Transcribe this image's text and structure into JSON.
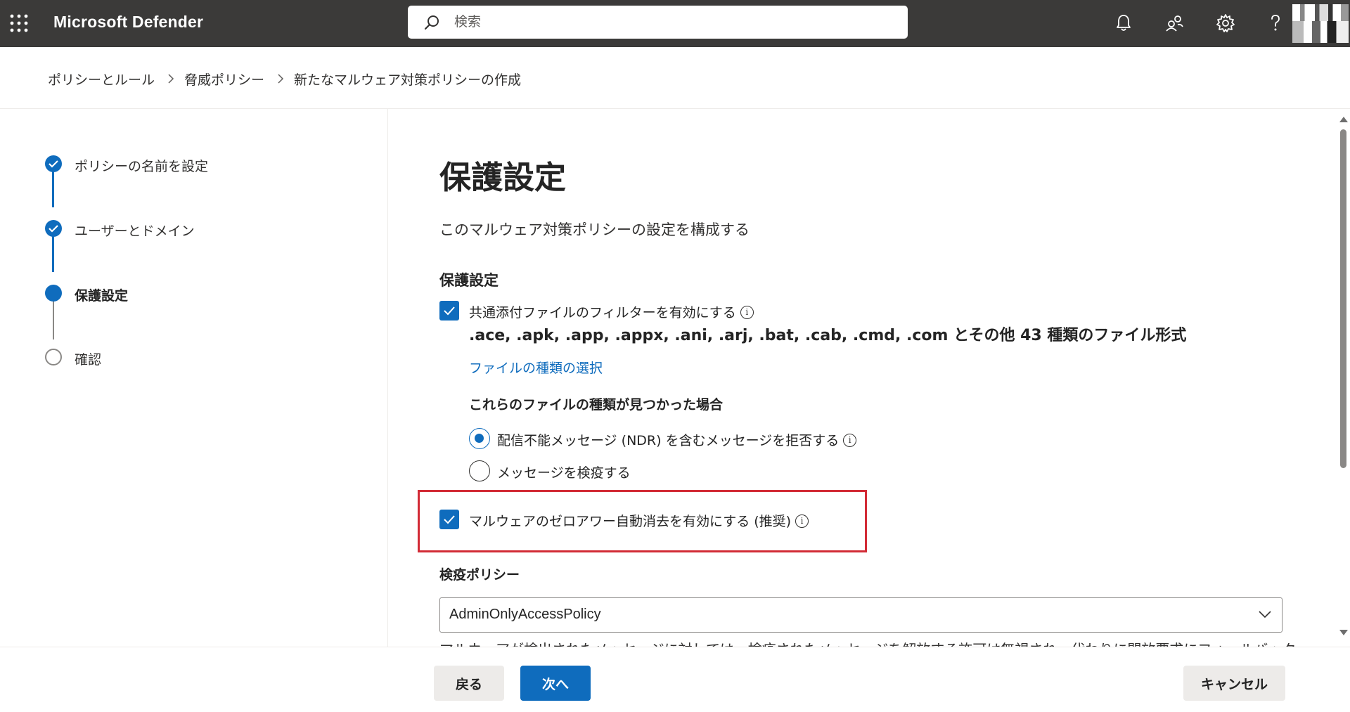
{
  "app": {
    "product_name": "Microsoft Defender"
  },
  "search": {
    "placeholder": "検索"
  },
  "header_icons": [
    "waffle-icon",
    "search-icon",
    "bell-icon",
    "people-icon",
    "gear-icon",
    "help-icon",
    "avatar"
  ],
  "breadcrumb": [
    "ポリシーとルール",
    "脅威ポリシー",
    "新たなマルウェア対策ポリシーの作成"
  ],
  "wizard": {
    "steps": [
      {
        "label": "ポリシーの名前を設定",
        "state": "done"
      },
      {
        "label": "ユーザーとドメイン",
        "state": "done"
      },
      {
        "label": "保護設定",
        "state": "current"
      },
      {
        "label": "確認",
        "state": "todo"
      }
    ]
  },
  "main": {
    "title": "保護設定",
    "description": "このマルウェア対策ポリシーの設定を構成する",
    "section_title": "保護設定",
    "common_attachments": {
      "label": "共通添付ファイルのフィルターを有効にする",
      "checked": true,
      "file_types": ".ace, .apk, .app, .appx, .ani, .arj, .bat, .cab, .cmd, .com とその他 43 種類のファイル形式",
      "select_link": "ファイルの種類の選択"
    },
    "when_found": {
      "title": "これらのファイルの種類が見つかった場合",
      "options": [
        {
          "label": "配信不能メッセージ (NDR) を含むメッセージを拒否する",
          "selected": true
        },
        {
          "label": "メッセージを検疫する",
          "selected": false
        }
      ]
    },
    "zap": {
      "label": "マルウェアのゼロアワー自動消去を有効にする (推奨)",
      "checked": true
    },
    "quarantine": {
      "title": "検疫ポリシー",
      "value": "AdminOnlyAccessPolicy",
      "helper_text": "マルウェアが検出されたメッセージに対しては、検疫されたメッセージを解放する許可は無視され、代わりに開放要求にフォールバック"
    }
  },
  "footer": {
    "back": "戻る",
    "next": "次へ",
    "cancel": "キャンセル"
  },
  "colors": {
    "accent": "#0f6cbd",
    "topbar": "#3b3a39",
    "highlight": "#d22b36"
  }
}
